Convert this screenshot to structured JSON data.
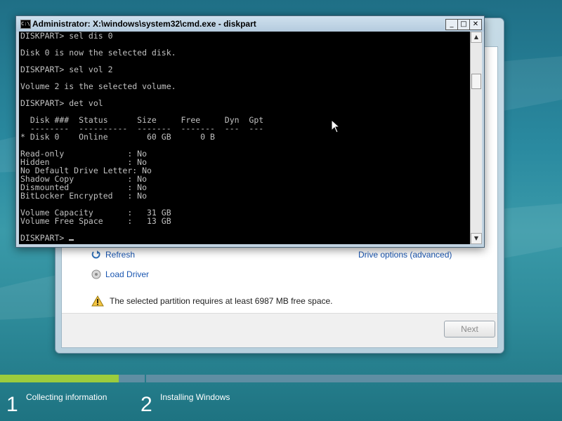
{
  "cmd_window": {
    "title": "Administrator: X:\\windows\\system32\\cmd.exe - diskpart",
    "title_icon_text": "C:\\",
    "buttons": {
      "minimize": "_",
      "maximize": "□",
      "close": "✕"
    },
    "console_lines": [
      "DISKPART> sel dis 0",
      "",
      "Disk 0 is now the selected disk.",
      "",
      "DISKPART> sel vol 2",
      "",
      "Volume 2 is the selected volume.",
      "",
      "DISKPART> det vol",
      "",
      "  Disk ###  Status      Size     Free     Dyn  Gpt",
      "  --------  ----------  -------  -------  ---  ---",
      "* Disk 0    Online        60 GB      0 B",
      "",
      "Read-only             : No",
      "Hidden                : No",
      "No Default Drive Letter: No",
      "Shadow Copy           : No",
      "Dismounted            : No",
      "BitLocker Encrypted   : No",
      "",
      "Volume Capacity       :   31 GB",
      "Volume Free Space     :   13 GB",
      "",
      "DISKPART> "
    ]
  },
  "setup": {
    "links": {
      "refresh": "Refresh",
      "load_driver": "Load Driver",
      "drive_options": "Drive options (advanced)"
    },
    "warning": "The selected partition requires at least 6987 MB free space.",
    "next_button": "Next"
  },
  "progress": {
    "step1_fraction": 0.82,
    "steps": [
      {
        "number": "1",
        "label": "Collecting information"
      },
      {
        "number": "2",
        "label": "Installing Windows"
      }
    ]
  },
  "colors": {
    "console_bg": "#000000",
    "console_text": "#c0c0c0",
    "progress_fill": "#9ccc3d",
    "link": "#1a56b0"
  }
}
